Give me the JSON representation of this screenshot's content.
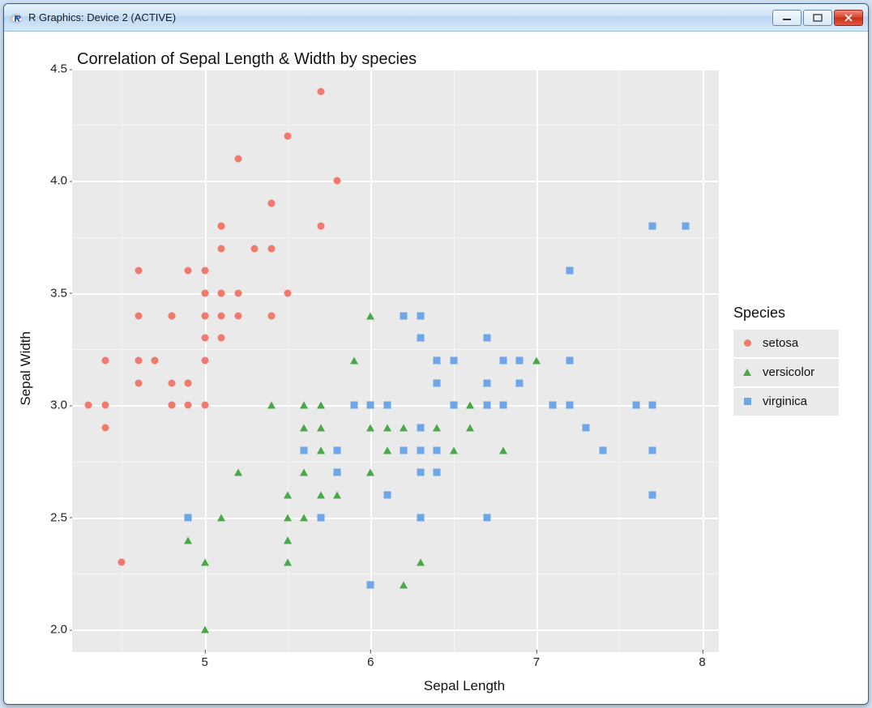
{
  "window": {
    "title": "R Graphics: Device 2 (ACTIVE)"
  },
  "chart_data": {
    "type": "scatter",
    "title": "Correlation of Sepal Length & Width by species",
    "xlabel": "Sepal Length",
    "ylabel": "Sepal Width",
    "xlim": [
      4.2,
      8.1
    ],
    "ylim": [
      1.9,
      4.5
    ],
    "xticks": [
      5,
      6,
      7,
      8
    ],
    "yticks": [
      2.0,
      2.5,
      3.0,
      3.5,
      4.0,
      4.5
    ],
    "xminor": [
      4.5,
      5.5,
      6.5,
      7.5
    ],
    "yminor": [
      2.25,
      2.75,
      3.25,
      3.75,
      4.25
    ],
    "legend_title": "Species",
    "series": [
      {
        "name": "setosa",
        "shape": "circle",
        "color": "#f07a6e",
        "data": [
          [
            5.1,
            3.5
          ],
          [
            4.9,
            3.0
          ],
          [
            4.7,
            3.2
          ],
          [
            4.6,
            3.1
          ],
          [
            5.0,
            3.6
          ],
          [
            5.4,
            3.9
          ],
          [
            4.6,
            3.4
          ],
          [
            5.0,
            3.4
          ],
          [
            4.4,
            2.9
          ],
          [
            4.9,
            3.1
          ],
          [
            5.4,
            3.7
          ],
          [
            4.8,
            3.4
          ],
          [
            4.8,
            3.0
          ],
          [
            4.3,
            3.0
          ],
          [
            5.8,
            4.0
          ],
          [
            5.7,
            4.4
          ],
          [
            5.4,
            3.9
          ],
          [
            5.1,
            3.5
          ],
          [
            5.7,
            3.8
          ],
          [
            5.1,
            3.8
          ],
          [
            5.4,
            3.4
          ],
          [
            5.1,
            3.7
          ],
          [
            4.6,
            3.6
          ],
          [
            5.1,
            3.3
          ],
          [
            4.8,
            3.4
          ],
          [
            5.0,
            3.0
          ],
          [
            5.0,
            3.4
          ],
          [
            5.2,
            3.5
          ],
          [
            5.2,
            3.4
          ],
          [
            4.7,
            3.2
          ],
          [
            4.8,
            3.1
          ],
          [
            5.4,
            3.4
          ],
          [
            5.2,
            4.1
          ],
          [
            5.5,
            4.2
          ],
          [
            4.9,
            3.1
          ],
          [
            5.0,
            3.2
          ],
          [
            5.5,
            3.5
          ],
          [
            4.9,
            3.6
          ],
          [
            4.4,
            3.0
          ],
          [
            5.1,
            3.4
          ],
          [
            5.0,
            3.5
          ],
          [
            4.5,
            2.3
          ],
          [
            4.4,
            3.2
          ],
          [
            5.0,
            3.5
          ],
          [
            5.1,
            3.8
          ],
          [
            4.8,
            3.0
          ],
          [
            5.1,
            3.8
          ],
          [
            4.6,
            3.2
          ],
          [
            5.3,
            3.7
          ],
          [
            5.0,
            3.3
          ]
        ]
      },
      {
        "name": "versicolor",
        "shape": "triangle",
        "color": "#4aa84a",
        "data": [
          [
            7.0,
            3.2
          ],
          [
            6.4,
            3.2
          ],
          [
            6.9,
            3.1
          ],
          [
            5.5,
            2.3
          ],
          [
            6.5,
            2.8
          ],
          [
            5.7,
            2.8
          ],
          [
            6.3,
            3.3
          ],
          [
            4.9,
            2.4
          ],
          [
            6.6,
            2.9
          ],
          [
            5.2,
            2.7
          ],
          [
            5.0,
            2.0
          ],
          [
            5.9,
            3.0
          ],
          [
            6.0,
            2.2
          ],
          [
            6.1,
            2.9
          ],
          [
            5.6,
            2.9
          ],
          [
            6.7,
            3.1
          ],
          [
            5.6,
            3.0
          ],
          [
            5.8,
            2.7
          ],
          [
            6.2,
            2.2
          ],
          [
            5.6,
            2.5
          ],
          [
            5.9,
            3.2
          ],
          [
            6.1,
            2.8
          ],
          [
            6.3,
            2.5
          ],
          [
            6.1,
            2.8
          ],
          [
            6.4,
            2.9
          ],
          [
            6.6,
            3.0
          ],
          [
            6.8,
            2.8
          ],
          [
            6.7,
            3.0
          ],
          [
            6.0,
            2.9
          ],
          [
            5.7,
            2.6
          ],
          [
            5.5,
            2.4
          ],
          [
            5.5,
            2.4
          ],
          [
            5.8,
            2.7
          ],
          [
            6.0,
            2.7
          ],
          [
            5.4,
            3.0
          ],
          [
            6.0,
            3.4
          ],
          [
            6.7,
            3.1
          ],
          [
            6.3,
            2.3
          ],
          [
            5.6,
            3.0
          ],
          [
            5.5,
            2.5
          ],
          [
            5.5,
            2.6
          ],
          [
            6.1,
            3.0
          ],
          [
            5.8,
            2.6
          ],
          [
            5.0,
            2.3
          ],
          [
            5.6,
            2.7
          ],
          [
            5.7,
            3.0
          ],
          [
            5.7,
            2.9
          ],
          [
            6.2,
            2.9
          ],
          [
            5.1,
            2.5
          ],
          [
            5.7,
            2.8
          ]
        ]
      },
      {
        "name": "virginica",
        "shape": "square",
        "color": "#6ea6e8",
        "data": [
          [
            6.3,
            3.3
          ],
          [
            5.8,
            2.7
          ],
          [
            7.1,
            3.0
          ],
          [
            6.3,
            2.9
          ],
          [
            6.5,
            3.0
          ],
          [
            7.6,
            3.0
          ],
          [
            4.9,
            2.5
          ],
          [
            7.3,
            2.9
          ],
          [
            6.7,
            2.5
          ],
          [
            7.2,
            3.6
          ],
          [
            6.5,
            3.2
          ],
          [
            6.4,
            2.7
          ],
          [
            6.8,
            3.0
          ],
          [
            5.7,
            2.5
          ],
          [
            5.8,
            2.8
          ],
          [
            6.4,
            3.2
          ],
          [
            6.5,
            3.0
          ],
          [
            7.7,
            3.8
          ],
          [
            7.7,
            2.6
          ],
          [
            6.0,
            2.2
          ],
          [
            6.9,
            3.2
          ],
          [
            5.6,
            2.8
          ],
          [
            7.7,
            2.8
          ],
          [
            6.3,
            2.7
          ],
          [
            6.7,
            3.3
          ],
          [
            7.2,
            3.2
          ],
          [
            6.2,
            2.8
          ],
          [
            6.1,
            3.0
          ],
          [
            6.4,
            2.8
          ],
          [
            7.2,
            3.0
          ],
          [
            7.4,
            2.8
          ],
          [
            7.9,
            3.8
          ],
          [
            6.4,
            2.8
          ],
          [
            6.3,
            2.8
          ],
          [
            6.1,
            2.6
          ],
          [
            7.7,
            3.0
          ],
          [
            6.3,
            3.4
          ],
          [
            6.4,
            3.1
          ],
          [
            6.0,
            3.0
          ],
          [
            6.9,
            3.1
          ],
          [
            6.7,
            3.1
          ],
          [
            6.9,
            3.1
          ],
          [
            5.8,
            2.7
          ],
          [
            6.8,
            3.2
          ],
          [
            6.7,
            3.3
          ],
          [
            6.7,
            3.0
          ],
          [
            6.3,
            2.5
          ],
          [
            6.5,
            3.0
          ],
          [
            6.2,
            3.4
          ],
          [
            5.9,
            3.0
          ]
        ]
      }
    ]
  }
}
